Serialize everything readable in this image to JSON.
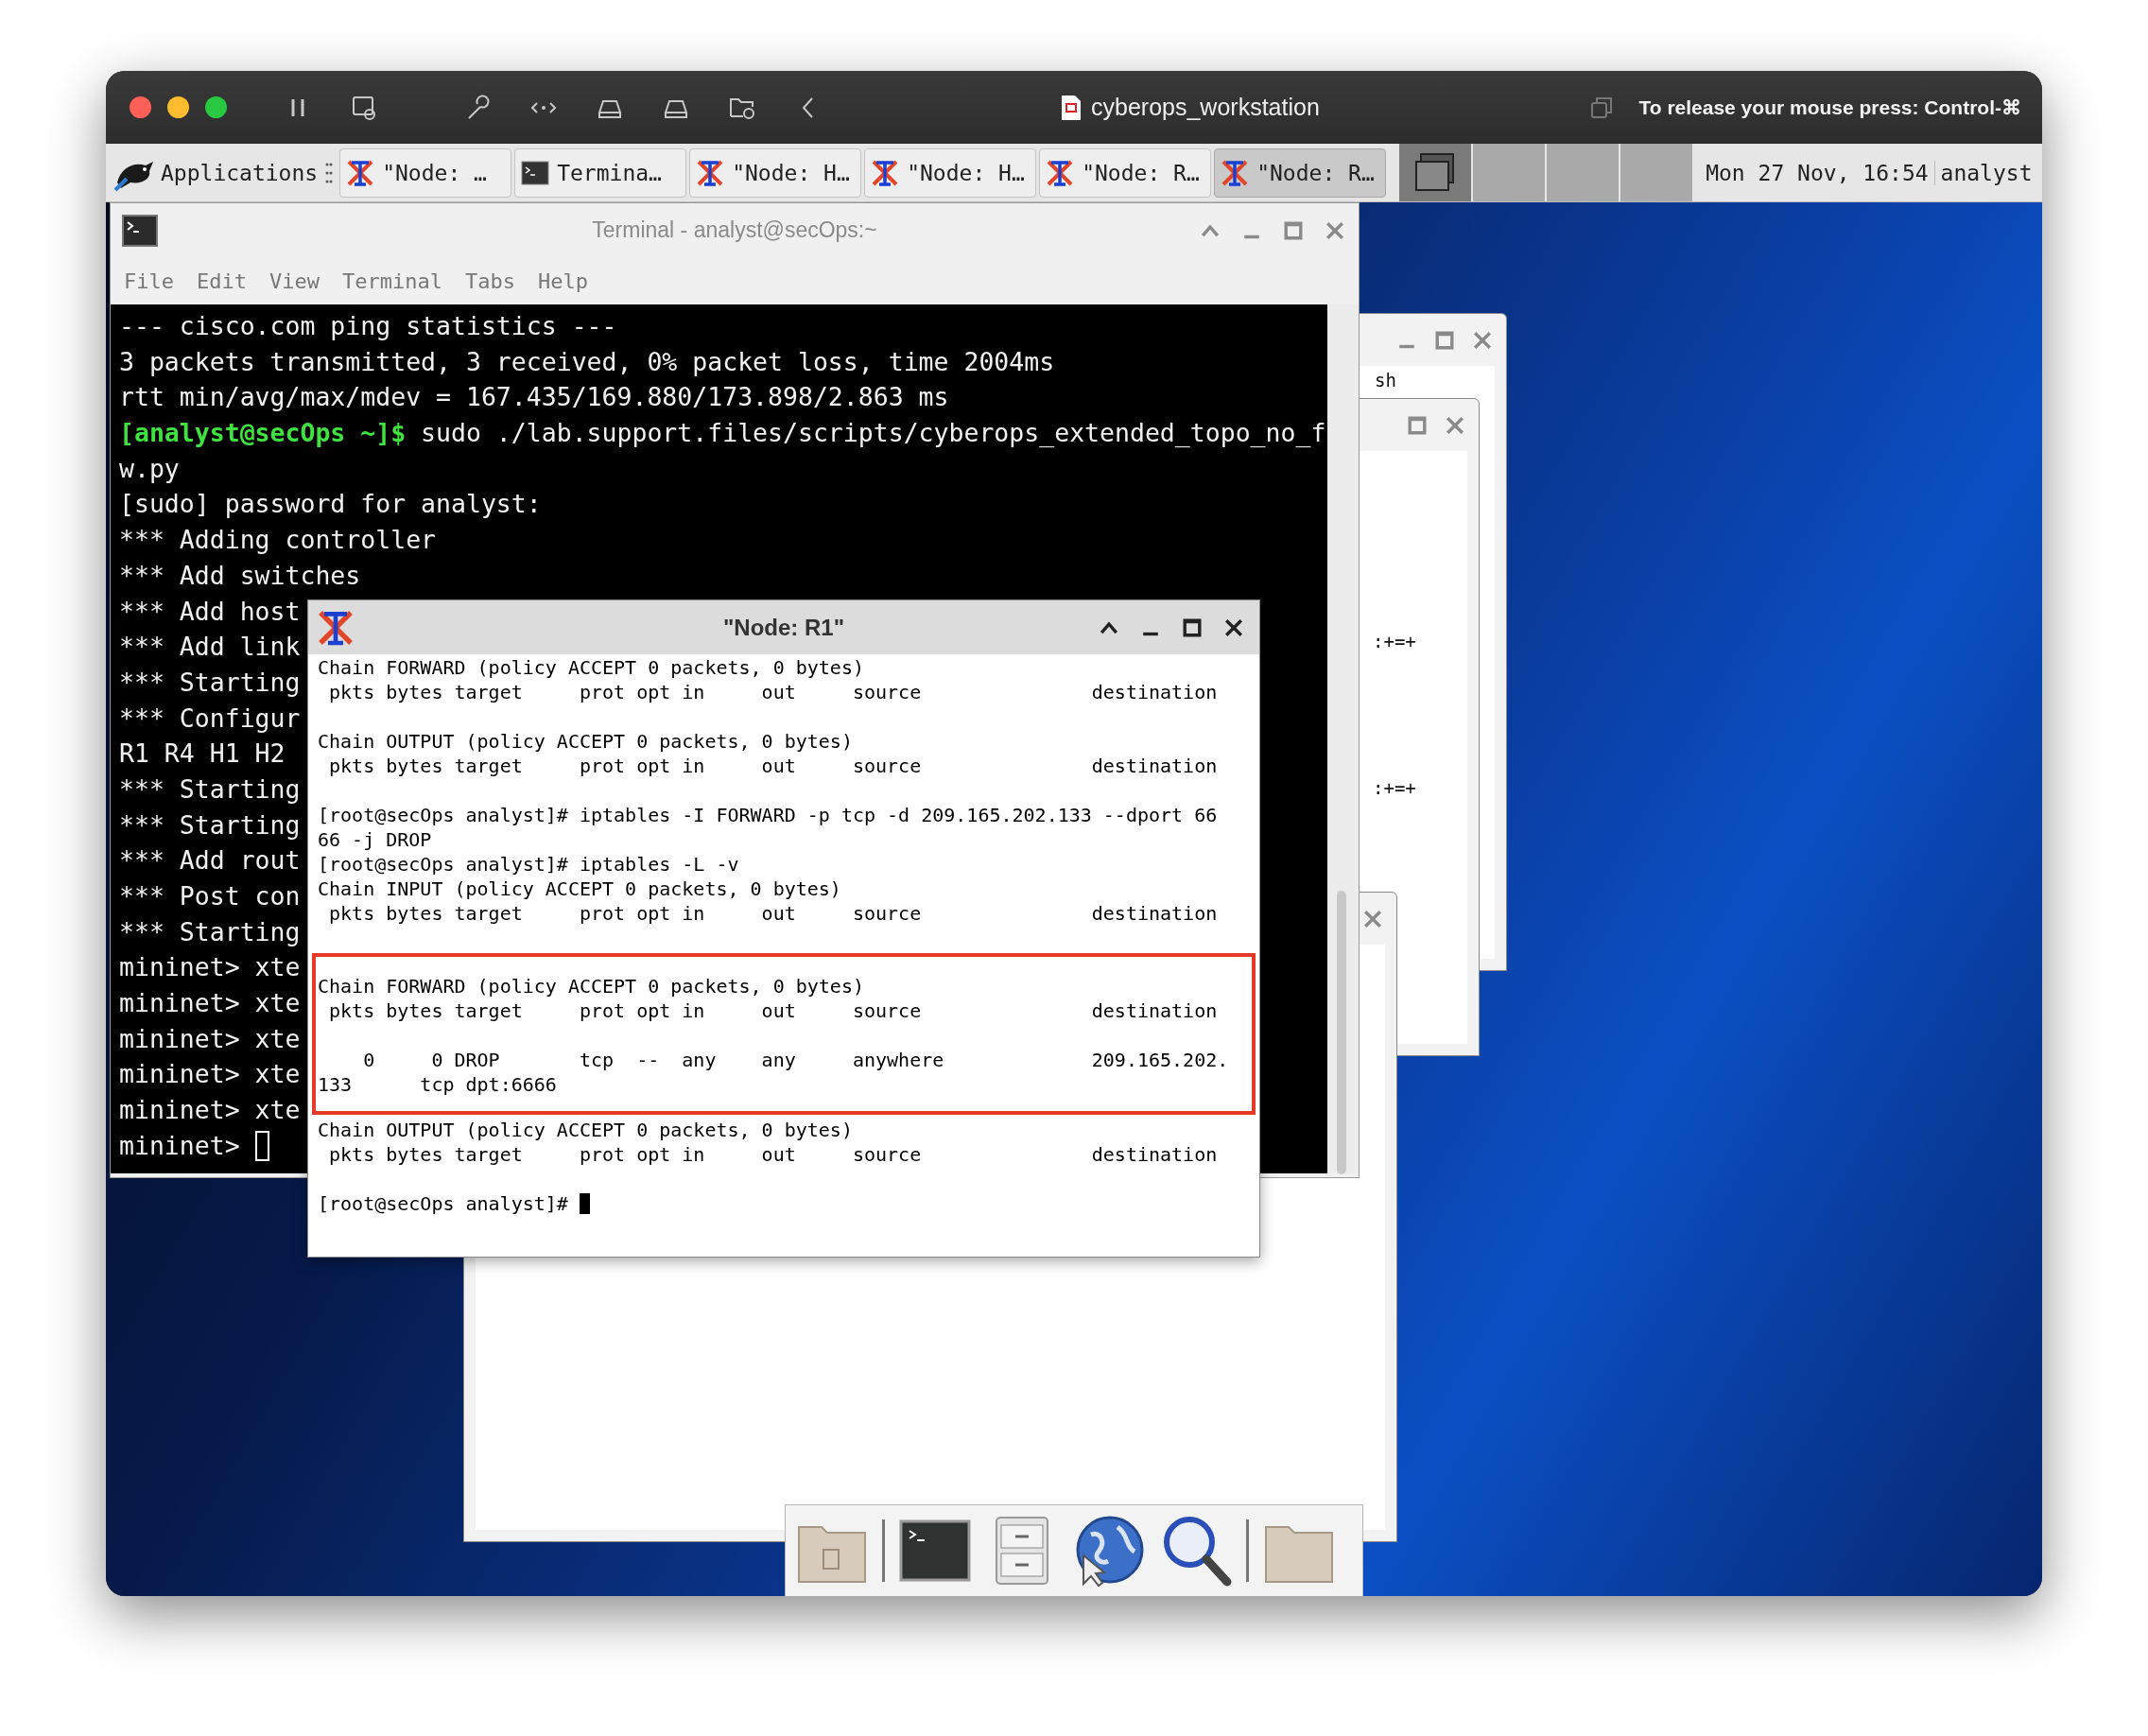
{
  "host_window": {
    "title": "cyberops_workstation",
    "release_hint": "To release your mouse press: Control-⌘"
  },
  "taskbar": {
    "menu_label": "Applications",
    "tasks": [
      {
        "label": "\"Node: …",
        "kind": "xterm",
        "selected": false
      },
      {
        "label": "Termina…",
        "kind": "terminal",
        "selected": false
      },
      {
        "label": "\"Node: H…",
        "kind": "xterm",
        "selected": false
      },
      {
        "label": "\"Node: H…",
        "kind": "xterm",
        "selected": false
      },
      {
        "label": "\"Node: R…",
        "kind": "xterm",
        "selected": false
      },
      {
        "label": "\"Node: R…",
        "kind": "xterm",
        "selected": true
      }
    ],
    "workspaces": [
      {
        "selected": true
      },
      {
        "selected": false
      },
      {
        "selected": false
      },
      {
        "selected": false
      }
    ],
    "clock": "Mon 27 Nov, 16:54",
    "user": "analyst"
  },
  "background_windows": [
    {
      "texts": [
        "sh"
      ]
    },
    {
      "texts": [
        ":+=+",
        ":+=+"
      ]
    }
  ],
  "terminal": {
    "title": "Terminal - analyst@secOps:~",
    "menu": [
      "File",
      "Edit",
      "View",
      "Terminal",
      "Tabs",
      "Help"
    ],
    "lines": [
      {
        "kind": "output",
        "text": "--- cisco.com ping statistics ---"
      },
      {
        "kind": "output",
        "text": "3 packets transmitted, 3 received, 0% packet loss, time 2004ms"
      },
      {
        "kind": "output",
        "text": "rtt min/avg/max/mdev = 167.435/169.880/173.898/2.863 ms"
      },
      {
        "kind": "prompt",
        "prompt": "[analyst@secOps ~]$",
        "text": " sudo ./lab.support.files/scripts/cyberops_extended_topo_no_f"
      },
      {
        "kind": "output",
        "text": "w.py"
      },
      {
        "kind": "output",
        "text": "[sudo] password for analyst:"
      },
      {
        "kind": "output",
        "text": "*** Adding controller"
      },
      {
        "kind": "output",
        "text": "*** Add switches"
      },
      {
        "kind": "output",
        "text": "*** Add host"
      },
      {
        "kind": "output",
        "text": "*** Add link"
      },
      {
        "kind": "output",
        "text": "*** Starting"
      },
      {
        "kind": "output",
        "text": "*** Configur"
      },
      {
        "kind": "output",
        "text": "R1 R4 H1 H2"
      },
      {
        "kind": "output",
        "text": "*** Starting"
      },
      {
        "kind": "output",
        "text": "*** Starting"
      },
      {
        "kind": "output",
        "text": "*** Add rout"
      },
      {
        "kind": "output",
        "text": "*** Post con"
      },
      {
        "kind": "output",
        "text": "*** Starting"
      },
      {
        "kind": "output",
        "text": "mininet> xte"
      },
      {
        "kind": "output",
        "text": "mininet> xte"
      },
      {
        "kind": "output",
        "text": "mininet> xte"
      },
      {
        "kind": "output",
        "text": "mininet> xte"
      },
      {
        "kind": "output",
        "text": "mininet> xte"
      },
      {
        "kind": "cursor",
        "text": "mininet>"
      }
    ]
  },
  "node_window": {
    "title": "\"Node: R1\"",
    "sections": [
      {
        "highlighted": false,
        "paragraphs": [
          [
            "Chain FORWARD (policy ACCEPT 0 packets, 0 bytes)",
            " pkts bytes target     prot opt in     out     source               destination"
          ],
          [
            "Chain OUTPUT (policy ACCEPT 0 packets, 0 bytes)",
            " pkts bytes target     prot opt in     out     source               destination"
          ],
          [
            "[root@secOps analyst]# iptables -I FORWARD -p tcp -d 209.165.202.133 --dport 66",
            "66 -j DROP",
            "[root@secOps analyst]# iptables -L -v",
            "Chain INPUT (policy ACCEPT 0 packets, 0 bytes)",
            " pkts bytes target     prot opt in     out     source               destination"
          ]
        ]
      },
      {
        "highlighted": true,
        "paragraphs": [
          [
            "Chain FORWARD (policy ACCEPT 0 packets, 0 bytes)",
            " pkts bytes target     prot opt in     out     source               destination"
          ],
          [
            "    0     0 DROP       tcp  --  any    any     anywhere             209.165.202.",
            "133      tcp dpt:6666"
          ]
        ]
      },
      {
        "highlighted": false,
        "paragraphs": [
          [
            "Chain OUTPUT (policy ACCEPT 0 packets, 0 bytes)",
            " pkts bytes target     prot opt in     out     source               destination"
          ]
        ]
      }
    ],
    "prompt": "[root@secOps analyst]#"
  }
}
